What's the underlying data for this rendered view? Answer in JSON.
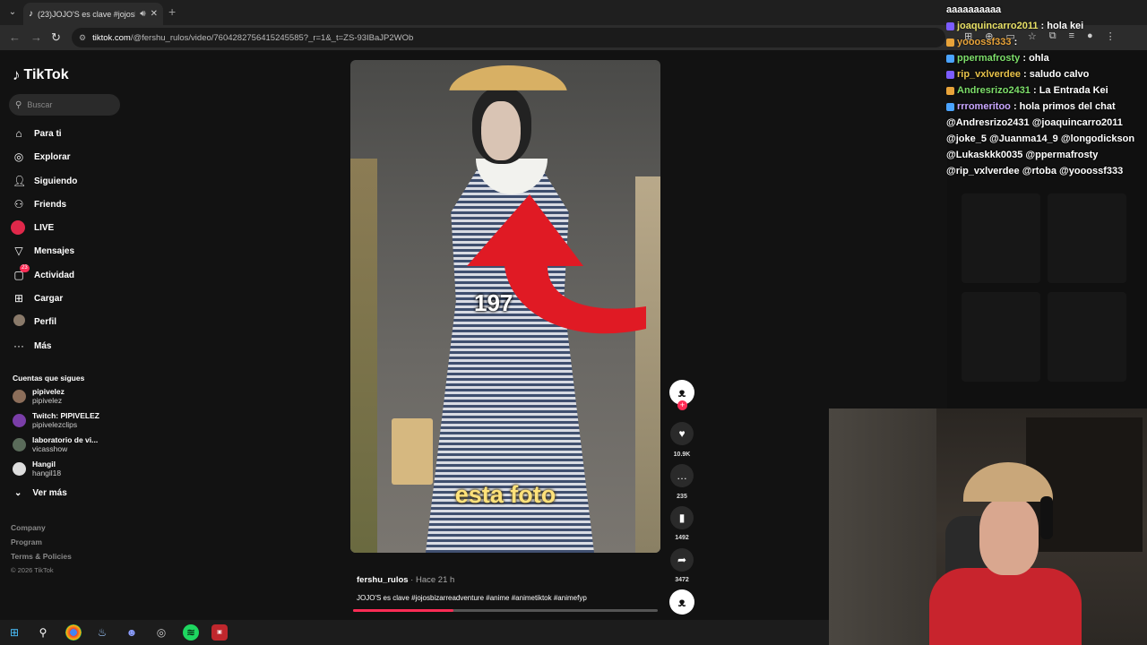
{
  "browser": {
    "tab_title": "(23)JOJO'S es clave #jojosb",
    "url_host": "tiktok.com",
    "url_path": "/@fershu_rulos/video/7604282756415245585?_r=1&_t=ZS-93IBaJP2WOb"
  },
  "sidebar": {
    "logo": "TikTok",
    "search_placeholder": "Buscar",
    "nav": [
      {
        "label": "Para ti",
        "icon": "home-icon"
      },
      {
        "label": "Explorar",
        "icon": "compass-icon"
      },
      {
        "label": "Siguiendo",
        "icon": "following-icon"
      },
      {
        "label": "Friends",
        "icon": "friends-icon"
      },
      {
        "label": "LIVE",
        "icon": "live-icon"
      },
      {
        "label": "Mensajes",
        "icon": "messages-icon"
      },
      {
        "label": "Actividad",
        "icon": "activity-icon",
        "badge": "23"
      },
      {
        "label": "Cargar",
        "icon": "upload-icon"
      },
      {
        "label": "Perfil",
        "icon": "profile-icon"
      },
      {
        "label": "Más",
        "icon": "more-icon"
      }
    ],
    "following_title": "Cuentas que sigues",
    "accounts": [
      {
        "name": "pipivelez",
        "handle": "pipivelez"
      },
      {
        "name": "Twitch: PIPIVELEZ",
        "handle": "pipivelezclips"
      },
      {
        "name": "laboratorio de vi...",
        "handle": "vicasshow"
      },
      {
        "name": "Hangil",
        "handle": "hangil18"
      }
    ],
    "see_more": "Ver más",
    "footer": [
      "Company",
      "Program",
      "Terms & Policies"
    ],
    "copyright": "© 2026 TikTok"
  },
  "video": {
    "overlay_year": "197",
    "overlay_caption": "esta foto",
    "author": "fershu_rulos",
    "time": " · Hace 21 h",
    "description": "JOJO'S es clave #jojosbizarreadventure #anime #animetiktok #animefyp",
    "progress": 0.33,
    "likes": "10.9K",
    "comments": "235",
    "saves": "1492",
    "shares": "3472"
  },
  "chat": {
    "lines": [
      {
        "user": "",
        "msg": "aaaaaaaaaa",
        "color": "#ffffff"
      },
      {
        "user": "joaquincarro2011",
        "msg": " : hola kei",
        "color": "#e8e066"
      },
      {
        "user": "yooossf333",
        "msg": " : ",
        "color": "#e8a33a"
      },
      {
        "user": "ppermafrosty",
        "msg": " : ohla",
        "color": "#7dde6a"
      },
      {
        "user": "rip_vxlverdee",
        "msg": " : saludo calvo",
        "color": "#e8c24a"
      },
      {
        "user": "Andresrizo2431",
        "msg": " : La Entrada Kei",
        "color": "#7dde6a"
      },
      {
        "user": "rrromeritoo",
        "msg": " : hola primos del chat",
        "color": "#c9a6ff"
      }
    ],
    "mentions": [
      "@Andresrizo2431 @joaquincarro2011",
      "@joke_5 @Juanma14_9 @longodickson",
      "@Lukaskkk0035 @ppermafrosty",
      "@rip_vxlverdee @rtoba @yooossf333"
    ]
  },
  "colors": {
    "accent": "#fe2c55",
    "background": "#121212"
  }
}
